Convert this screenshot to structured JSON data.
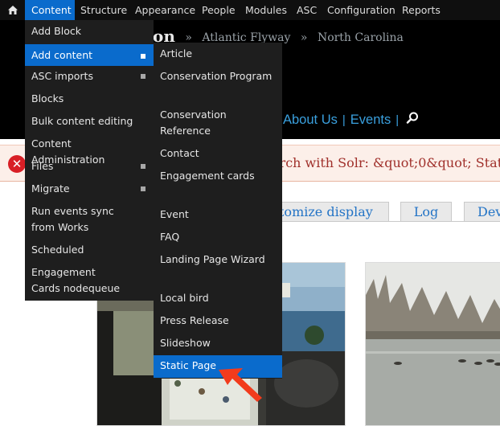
{
  "toolbar": {
    "home_icon": "home-icon",
    "items": [
      {
        "label": "Content",
        "active": true
      },
      {
        "label": "Structure"
      },
      {
        "label": "Appearance"
      },
      {
        "label": "People"
      },
      {
        "label": "Modules"
      },
      {
        "label": "ASC"
      },
      {
        "label": "Configuration"
      },
      {
        "label": "Reports"
      }
    ]
  },
  "breadcrumb": {
    "logo_tail": "on",
    "items": [
      "Atlantic Flyway",
      "North Carolina"
    ],
    "separator": "»"
  },
  "nav": {
    "items": [
      "About Us",
      "Events"
    ],
    "search_icon": "search-icon"
  },
  "error": {
    "icon": "error-x-icon",
    "text": "arch with Solr: &quot;0&quot; Stat"
  },
  "tabs": {
    "customize": "tomize display",
    "log": "Log",
    "dev": "Dev"
  },
  "content_menu": {
    "items": [
      {
        "label": "Add Block",
        "submenu": false
      },
      {
        "label": "Add content",
        "submenu": true,
        "highlighted": true
      },
      {
        "label": "ASC imports",
        "submenu": true
      },
      {
        "label": "Blocks",
        "submenu": false
      },
      {
        "label": "Bulk content editing",
        "submenu": false
      },
      {
        "label": "Content Administration",
        "submenu": false
      },
      {
        "label": "Files",
        "submenu": true
      },
      {
        "label": "Migrate",
        "submenu": true
      },
      {
        "label": "Run events sync from Works",
        "submenu": false
      },
      {
        "label": "Scheduled",
        "submenu": false
      },
      {
        "label": "Engagement Cards nodequeue",
        "submenu": false
      }
    ]
  },
  "add_content_menu": {
    "items": [
      {
        "label": "Article"
      },
      {
        "label": "Conservation Program"
      },
      {
        "label": "Conservation Reference"
      },
      {
        "label": "Contact"
      },
      {
        "label": "Engagement cards"
      },
      {
        "label": "Event"
      },
      {
        "label": "FAQ"
      },
      {
        "label": "Landing Page Wizard"
      },
      {
        "label": "Local bird"
      },
      {
        "label": "Press Release"
      },
      {
        "label": "Slideshow"
      },
      {
        "label": "Static Page",
        "highlighted": true
      }
    ]
  },
  "colors": {
    "toolbar_bg": "#0f0f0f",
    "menu_bg": "#1e1e1e",
    "highlight": "#0a6bcc",
    "link": "#3aa0de",
    "error_bg": "#fcefe9",
    "error_text": "#a0302b",
    "arrow": "#f23b1c"
  }
}
